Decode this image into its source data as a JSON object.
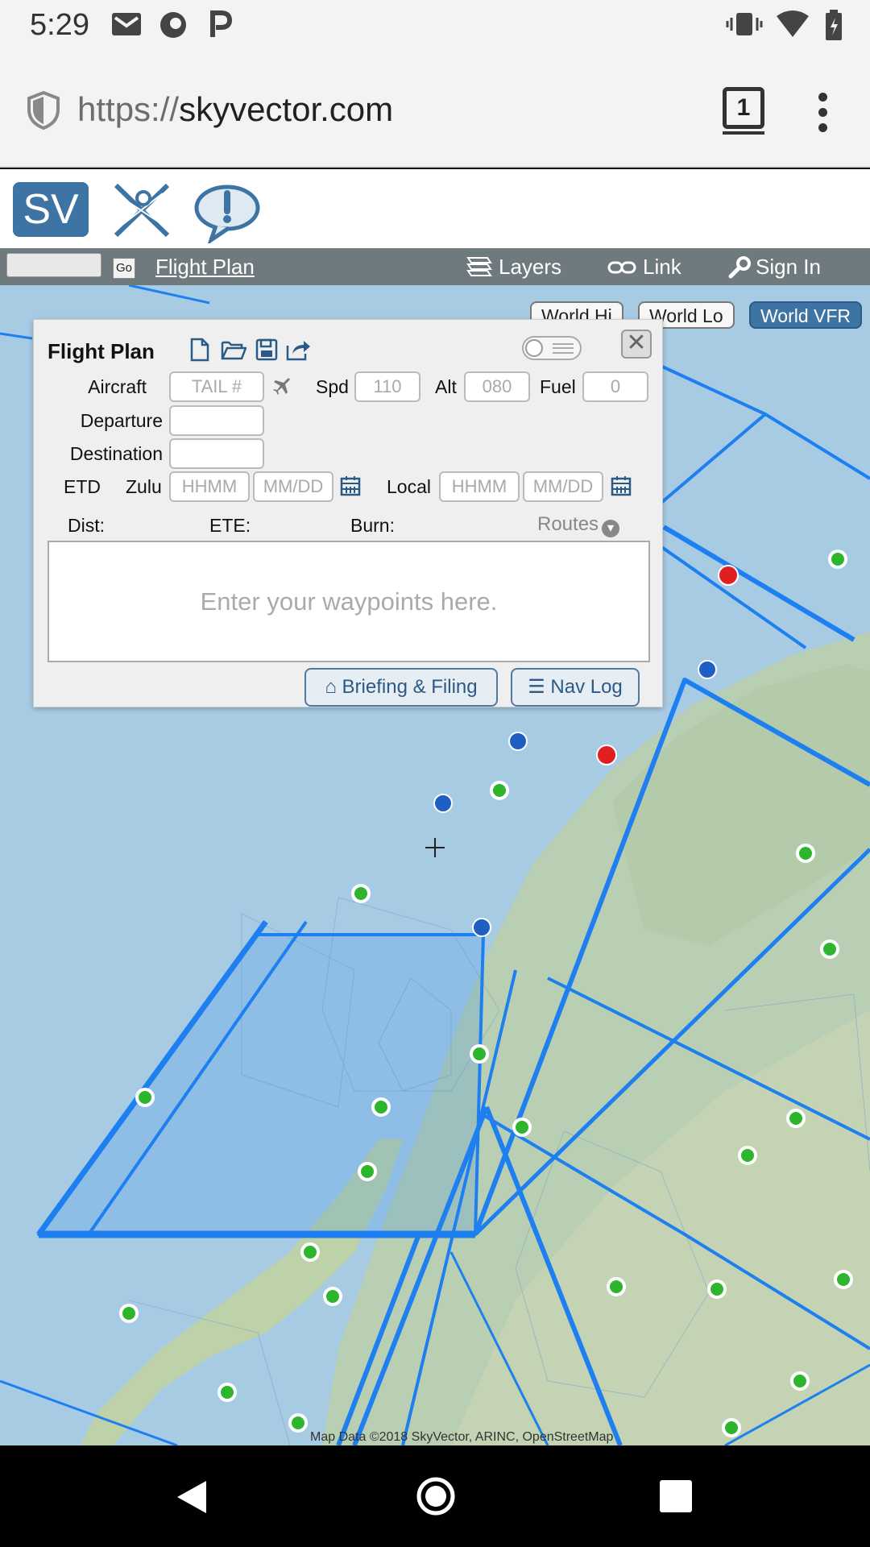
{
  "status_bar": {
    "time": "5:29",
    "icons": [
      "gmail-icon",
      "firefox-icon",
      "parking-icon",
      "vibrate-icon",
      "wifi-icon",
      "battery-icon"
    ]
  },
  "browser": {
    "url_scheme": "https://",
    "url_host": "skyvector.com",
    "tab_count": "1"
  },
  "site_header": {
    "logo_text": "SV"
  },
  "toolbar": {
    "go_label": "Go",
    "flight_plan_link": "Flight Plan",
    "layers_label": "Layers",
    "link_label": "Link",
    "sign_in_label": "Sign In"
  },
  "chart_buttons": {
    "world_hi": "World Hi",
    "world_lo": "World Lo",
    "world_vfr": "World VFR"
  },
  "flight_plan": {
    "title": "Flight Plan",
    "aircraft_label": "Aircraft",
    "tail_placeholder": "TAIL #",
    "spd_label": "Spd",
    "spd_value": "110",
    "alt_label": "Alt",
    "alt_value": "080",
    "fuel_label": "Fuel",
    "fuel_value": "0",
    "departure_label": "Departure",
    "destination_label": "Destination",
    "etd_label": "ETD",
    "zulu_label": "Zulu",
    "time_placeholder": "HHMM",
    "date_placeholder": "MM/DD",
    "local_label": "Local",
    "dist_label": "Dist:",
    "ete_label": "ETE:",
    "burn_label": "Burn:",
    "routes_label": "Routes",
    "waypoints_placeholder": "Enter your waypoints here.",
    "briefing_button": "Briefing & Filing",
    "navlog_button": "Nav Log"
  },
  "map": {
    "attribution": "Map Data ©2018 SkyVector, ARINC, OpenStreetMap",
    "colors": {
      "water": "#a8cbe4",
      "land": "#b7cdb8",
      "airspace": "#1e7ff0",
      "airport_green": "#2db52d",
      "airport_blue": "#1f5fc4",
      "airport_red": "#e02020"
    }
  },
  "colors": {
    "brand_blue": "#3d74a3",
    "toolbar": "#6f7a7e"
  }
}
